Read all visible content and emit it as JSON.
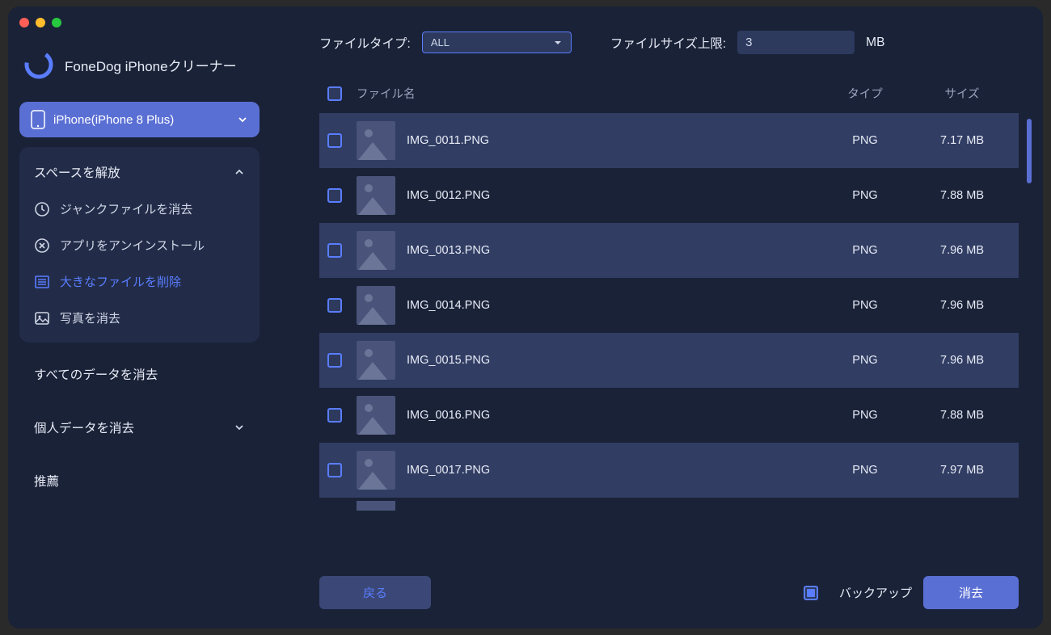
{
  "app_title": "FoneDog iPhoneクリーナー",
  "device": "iPhone(iPhone 8 Plus)",
  "sidebar": {
    "section_free_space": "スペースを解放",
    "items": [
      {
        "label": "ジャンクファイルを消去",
        "icon": "clock-icon"
      },
      {
        "label": "アプリをアンインストール",
        "icon": "x-circle-icon"
      },
      {
        "label": "大きなファイルを削除",
        "icon": "list-icon"
      },
      {
        "label": "写真を消去",
        "icon": "image-icon"
      }
    ],
    "section_erase_all": "すべてのデータを消去",
    "section_erase_personal": "個人データを消去",
    "section_recommend": "推薦"
  },
  "filters": {
    "filetype_label": "ファイルタイプ:",
    "filetype_value": "ALL",
    "size_label": "ファイルサイズ上限:",
    "size_value": "3",
    "size_unit": "MB"
  },
  "table": {
    "header_name": "ファイル名",
    "header_type": "タイプ",
    "header_size": "サイズ",
    "rows": [
      {
        "name": "IMG_0011.PNG",
        "type": "PNG",
        "size": "7.17 MB"
      },
      {
        "name": "IMG_0012.PNG",
        "type": "PNG",
        "size": "7.88 MB"
      },
      {
        "name": "IMG_0013.PNG",
        "type": "PNG",
        "size": "7.96 MB"
      },
      {
        "name": "IMG_0014.PNG",
        "type": "PNG",
        "size": "7.96 MB"
      },
      {
        "name": "IMG_0015.PNG",
        "type": "PNG",
        "size": "7.96 MB"
      },
      {
        "name": "IMG_0016.PNG",
        "type": "PNG",
        "size": "7.88 MB"
      },
      {
        "name": "IMG_0017.PNG",
        "type": "PNG",
        "size": "7.97 MB"
      }
    ]
  },
  "footer": {
    "back": "戻る",
    "backup": "バックアップ",
    "erase": "消去"
  }
}
